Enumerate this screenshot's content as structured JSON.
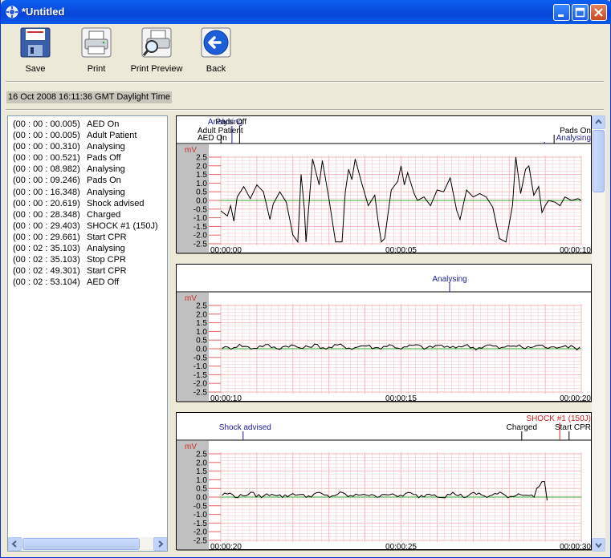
{
  "window": {
    "title": "*Untitled"
  },
  "toolbar": {
    "save_label": "Save",
    "print_label": "Print",
    "print_preview_label": "Print Preview",
    "back_label": "Back"
  },
  "datetime": "16 Oct 2008 16:11:36 GMT Daylight Time",
  "events": [
    {
      "time": "(00 : 00 : 00.005)",
      "label": "AED On"
    },
    {
      "time": "(00 : 00 : 00.005)",
      "label": "Adult Patient"
    },
    {
      "time": "(00 : 00 : 00.310)",
      "label": "Analysing"
    },
    {
      "time": "(00 : 00 : 00.521)",
      "label": "Pads Off"
    },
    {
      "time": "(00 : 00 : 08.982)",
      "label": "Analysing"
    },
    {
      "time": "(00 : 00 : 09.246)",
      "label": "Pads On"
    },
    {
      "time": "(00 : 00 : 16.348)",
      "label": "Analysing"
    },
    {
      "time": "(00 : 00 : 20.619)",
      "label": "Shock advised"
    },
    {
      "time": "(00 : 00 : 28.348)",
      "label": "Charged"
    },
    {
      "time": "(00 : 00 : 29.403)",
      "label": "SHOCK #1 (150J)"
    },
    {
      "time": "(00 : 00 : 29.661)",
      "label": "Start CPR"
    },
    {
      "time": "(00 : 02 : 35.103)",
      "label": "Analysing"
    },
    {
      "time": "(00 : 02 : 35.103)",
      "label": "Stop CPR"
    },
    {
      "time": "(00 : 02 : 49.301)",
      "label": "Start CPR"
    },
    {
      "time": "(00 : 02 : 53.104)",
      "label": "AED Off"
    }
  ],
  "colors": {
    "grid": "#f5b5b5",
    "trace": "#000000",
    "baseline": "#33aa33",
    "annotation_blue": "#1a1a9a",
    "annotation_red": "#d02020",
    "axis_gutter": "#c0c0c0"
  },
  "strips": [
    {
      "unit": "mV",
      "yticks": [
        "2.5",
        "2.0",
        "1.5",
        "1.0",
        "0.5",
        "0.0",
        "-0.5",
        "-1.0",
        "-1.5",
        "-2.0",
        "-2.5"
      ],
      "xticks": [
        "00:00:00",
        "00:00:05",
        "00:00:10"
      ],
      "annotations": [
        {
          "text": "AED On",
          "t": 0.005,
          "color": "black",
          "row": 3
        },
        {
          "text": "Adult Patient",
          "t": 0.005,
          "color": "black",
          "row": 2
        },
        {
          "text": "Analysing",
          "t": 0.31,
          "color": "blue",
          "row": 1
        },
        {
          "text": "Pads Off",
          "t": 0.521,
          "color": "black",
          "row": 1
        },
        {
          "text": "Analysing",
          "t": 8.982,
          "color": "blue",
          "row": 3
        },
        {
          "text": "Pads On",
          "t": 9.246,
          "color": "black",
          "row": 2
        }
      ],
      "trace": [
        [
          0,
          -0.6
        ],
        [
          0.2,
          -0.9
        ],
        [
          0.3,
          -0.3
        ],
        [
          0.4,
          -1.2
        ],
        [
          0.5,
          0.2
        ],
        [
          0.7,
          0.8
        ],
        [
          0.9,
          0.1
        ],
        [
          1.1,
          0.9
        ],
        [
          1.3,
          0.5
        ],
        [
          1.5,
          -1.1
        ],
        [
          1.6,
          -0.2
        ],
        [
          1.8,
          0.5
        ],
        [
          2.0,
          -0.1
        ],
        [
          2.2,
          -2.0
        ],
        [
          2.35,
          -2.4
        ],
        [
          2.45,
          1.5
        ],
        [
          2.55,
          -0.5
        ],
        [
          2.6,
          -2.4
        ],
        [
          2.8,
          2.4
        ],
        [
          3.0,
          0.9
        ],
        [
          3.1,
          2.3
        ],
        [
          3.3,
          0.1
        ],
        [
          3.5,
          -2.4
        ],
        [
          3.7,
          -2.4
        ],
        [
          3.8,
          0.5
        ],
        [
          3.9,
          1.8
        ],
        [
          4.0,
          1.2
        ],
        [
          4.1,
          2.4
        ],
        [
          4.3,
          1.0
        ],
        [
          4.5,
          -0.3
        ],
        [
          4.7,
          0.3
        ],
        [
          4.8,
          -1.2
        ],
        [
          4.9,
          -2.4
        ],
        [
          5.0,
          -2.2
        ],
        [
          5.2,
          0.6
        ],
        [
          5.4,
          1.1
        ],
        [
          5.5,
          2.0
        ],
        [
          5.6,
          0.9
        ],
        [
          5.7,
          1.6
        ],
        [
          5.9,
          0.4
        ],
        [
          6.0,
          0.0
        ],
        [
          6.2,
          0.2
        ],
        [
          6.4,
          -0.3
        ],
        [
          6.6,
          0.6
        ],
        [
          6.8,
          0.5
        ],
        [
          7.0,
          1.3
        ],
        [
          7.2,
          -0.6
        ],
        [
          7.3,
          -1.1
        ],
        [
          7.5,
          0.6
        ],
        [
          7.7,
          0.2
        ],
        [
          7.9,
          0.4
        ],
        [
          8.1,
          0.2
        ],
        [
          8.3,
          -0.4
        ],
        [
          8.5,
          -2.2
        ],
        [
          8.7,
          -2.4
        ],
        [
          8.9,
          -0.3
        ],
        [
          9.0,
          2.5
        ],
        [
          9.15,
          0.4
        ],
        [
          9.3,
          1.8
        ],
        [
          9.4,
          2.0
        ],
        [
          9.55,
          0.3
        ],
        [
          9.7,
          0.8
        ],
        [
          9.8,
          -0.7
        ],
        [
          9.9,
          -0.3
        ],
        [
          10.0,
          0.0
        ],
        [
          10.2,
          -0.1
        ],
        [
          10.35,
          -0.3
        ],
        [
          10.5,
          0.2
        ],
        [
          10.7,
          0.0
        ],
        [
          10.9,
          0.1
        ],
        [
          11.0,
          0.0
        ]
      ]
    },
    {
      "unit": "mV",
      "yticks": [
        "2.5",
        "2.0",
        "1.5",
        "1.0",
        "0.5",
        "0.0",
        "-0.5",
        "-1.0",
        "-1.5",
        "-2.0",
        "-2.5"
      ],
      "xticks": [
        "00:00:10",
        "00:00:15",
        "00:00:20"
      ],
      "annotations": [
        {
          "text": "Analysing",
          "t": 16.348,
          "color": "blue",
          "row": 2
        }
      ],
      "trace": "noise"
    },
    {
      "unit": "mV",
      "yticks": [
        "2.5",
        "2.0",
        "1.5",
        "1.0",
        "0.5",
        "0.0",
        "-0.5",
        "-1.0",
        "-1.5",
        "-2.0",
        "-2.5"
      ],
      "xticks": [
        "00:00:20",
        "00:00:25",
        "00:00:30"
      ],
      "annotations": [
        {
          "text": "Shock advised",
          "t": 20.619,
          "color": "blue",
          "row": 2
        },
        {
          "text": "Charged",
          "t": 28.348,
          "color": "black",
          "row": 2
        },
        {
          "text": "SHOCK #1 (150J)",
          "t": 29.403,
          "color": "red",
          "row": 1
        },
        {
          "text": "Start CPR",
          "t": 29.661,
          "color": "black",
          "row": 2
        }
      ],
      "trace": "noise-shock"
    }
  ]
}
